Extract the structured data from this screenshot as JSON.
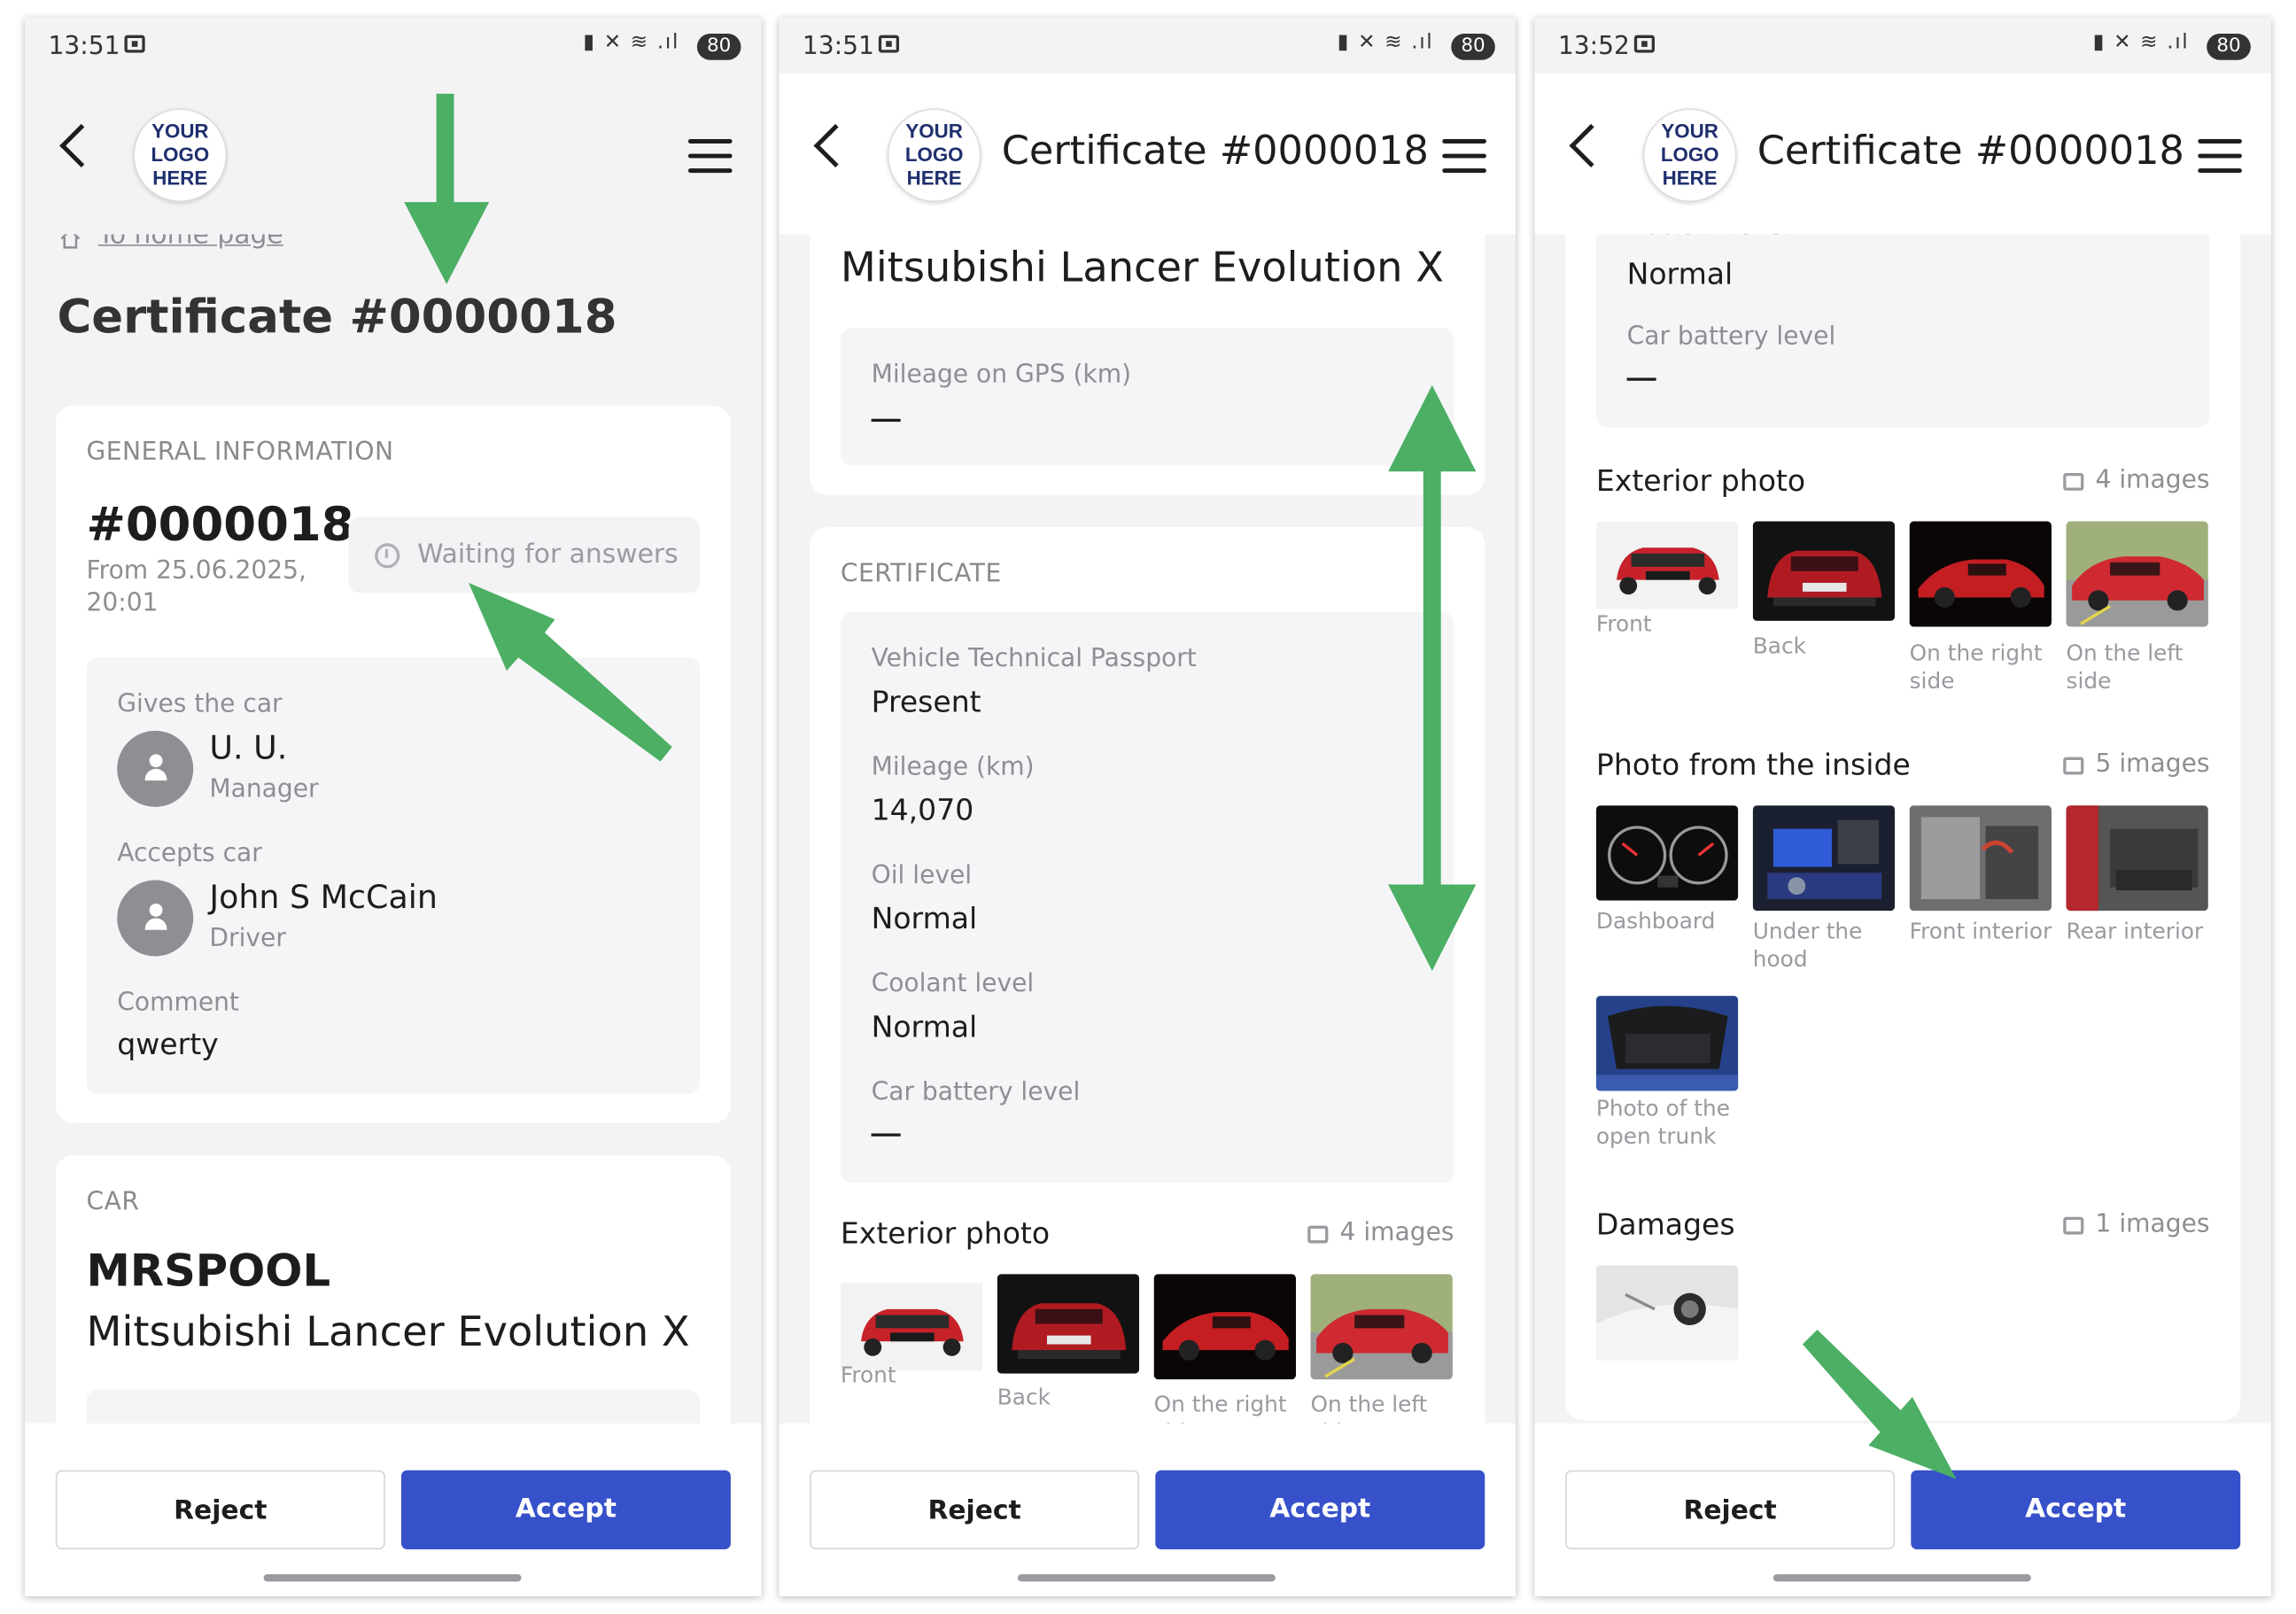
{
  "status_bar": {
    "panel1_time": "13:51",
    "panel2_time": "13:51",
    "panel3_time": "13:52",
    "icons": "▮ ✕ ≋ .ıl",
    "battery": "80"
  },
  "logo": {
    "line1": "YOUR",
    "line2": "LOGO",
    "line3": "HERE"
  },
  "header_title": "Certificate #0000018",
  "breadcrumb": {
    "home_label": "To home page"
  },
  "page_title": "Certificate #0000018",
  "general": {
    "section_label": "GENERAL INFORMATION",
    "number": "#0000018",
    "date_line1": "From 25.06.2025,",
    "date_line2": "20:01",
    "status": "Waiting for answers",
    "gives_label": "Gives the car",
    "gives_name": "U. U.",
    "gives_role": "Manager",
    "accepts_label": "Accepts car",
    "accepts_name": "John S McCain",
    "accepts_role": "Driver",
    "comment_label": "Comment",
    "comment_value": "qwerty"
  },
  "car": {
    "section_label": "CAR",
    "plate": "MRSPOOL",
    "model": "Mitsubishi Lancer Evolution X",
    "gps_label": "Mileage on GPS (km)"
  },
  "certificate": {
    "section_label": "CERTIFICATE",
    "fields": [
      {
        "label": "Vehicle Technical Passport",
        "value": "Present"
      },
      {
        "label": "Mileage (km)",
        "value": "14,070"
      },
      {
        "label": "Oil level",
        "value": "Normal"
      },
      {
        "label": "Coolant level",
        "value": "Normal"
      },
      {
        "label": "Car battery level",
        "value": ""
      }
    ],
    "partial_label": "Coolant level"
  },
  "exterior": {
    "title": "Exterior photo",
    "count": "4 images",
    "captions": [
      "Front",
      "Back",
      "On the right side",
      "On the left side"
    ]
  },
  "interior": {
    "title": "Photo from the inside",
    "count": "5 images",
    "captions": [
      "Dashboard",
      "Under the hood",
      "Front interior",
      "Rear interior",
      "Photo of the open trunk"
    ]
  },
  "damages": {
    "title": "Damages",
    "count": "1 images"
  },
  "actions": {
    "reject": "Reject",
    "accept": "Accept"
  },
  "colors": {
    "accent": "#3651c9",
    "arrow": "#4caf64",
    "background": "#f3f3f5"
  }
}
